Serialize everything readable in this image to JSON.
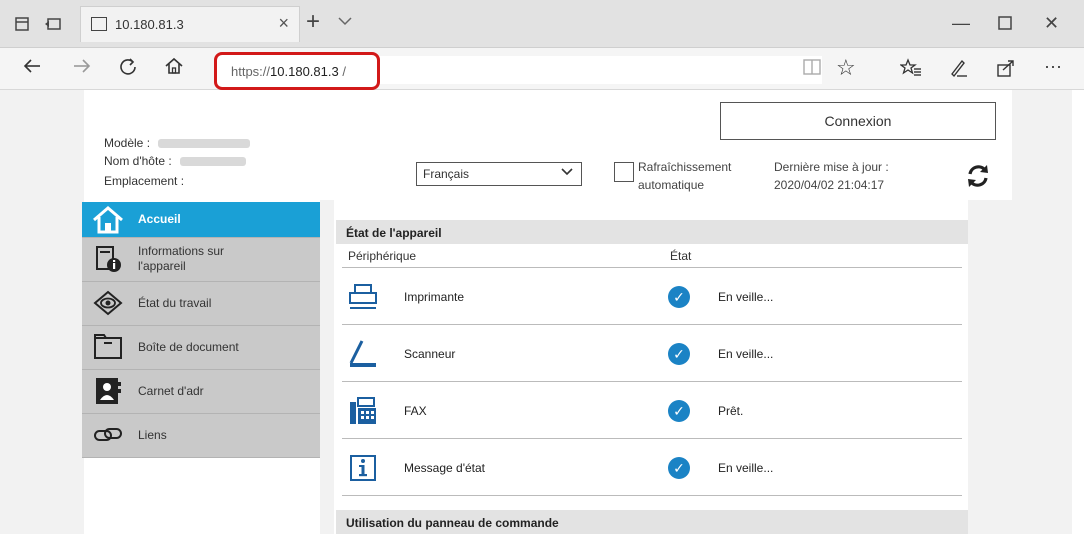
{
  "browser": {
    "tab_title": "10.180.81.3",
    "url_scheme": "https://",
    "url_host": "10.180.81.3",
    "url_tail": " /"
  },
  "header": {
    "model_label": "Modèle :",
    "hostname_label": "Nom d'hôte :",
    "location_label": "Emplacement :",
    "login_button": "Connexion",
    "language_selected": "Français",
    "auto_refresh_line1": "Rafraîchissement",
    "auto_refresh_line2": "automatique",
    "last_update_label": "Dernière mise à jour :",
    "last_update_value": "2020/04/02 21:04:17"
  },
  "sidebar": {
    "items": [
      {
        "label": "Accueil",
        "icon": "home-icon"
      },
      {
        "label_line1": "Informations sur",
        "label_line2": "l'appareil",
        "icon": "device-info-icon"
      },
      {
        "label": "État du travail",
        "icon": "eye-icon"
      },
      {
        "label": "Boîte de document",
        "icon": "folder-icon"
      },
      {
        "label": "Carnet d'adr",
        "icon": "address-book-icon"
      },
      {
        "label": "Liens",
        "icon": "link-icon"
      }
    ]
  },
  "device_status": {
    "title": "État de l'appareil",
    "col_device": "Périphérique",
    "col_state": "État",
    "rows": [
      {
        "name": "Imprimante",
        "state": "En veille...",
        "icon": "printer-icon"
      },
      {
        "name": "Scanneur",
        "state": "En veille...",
        "icon": "scanner-icon"
      },
      {
        "name": "FAX",
        "state": "Prêt.",
        "icon": "fax-icon"
      },
      {
        "name": "Message d'état",
        "state": "En veille...",
        "icon": "info-icon"
      }
    ]
  },
  "panel_usage": {
    "title": "Utilisation du panneau de commande"
  },
  "colors": {
    "accent": "#1aa0d6",
    "highlight_border": "#d21919",
    "check_blue": "#1b83c5",
    "sidebar_grey": "#c9c9c9"
  }
}
